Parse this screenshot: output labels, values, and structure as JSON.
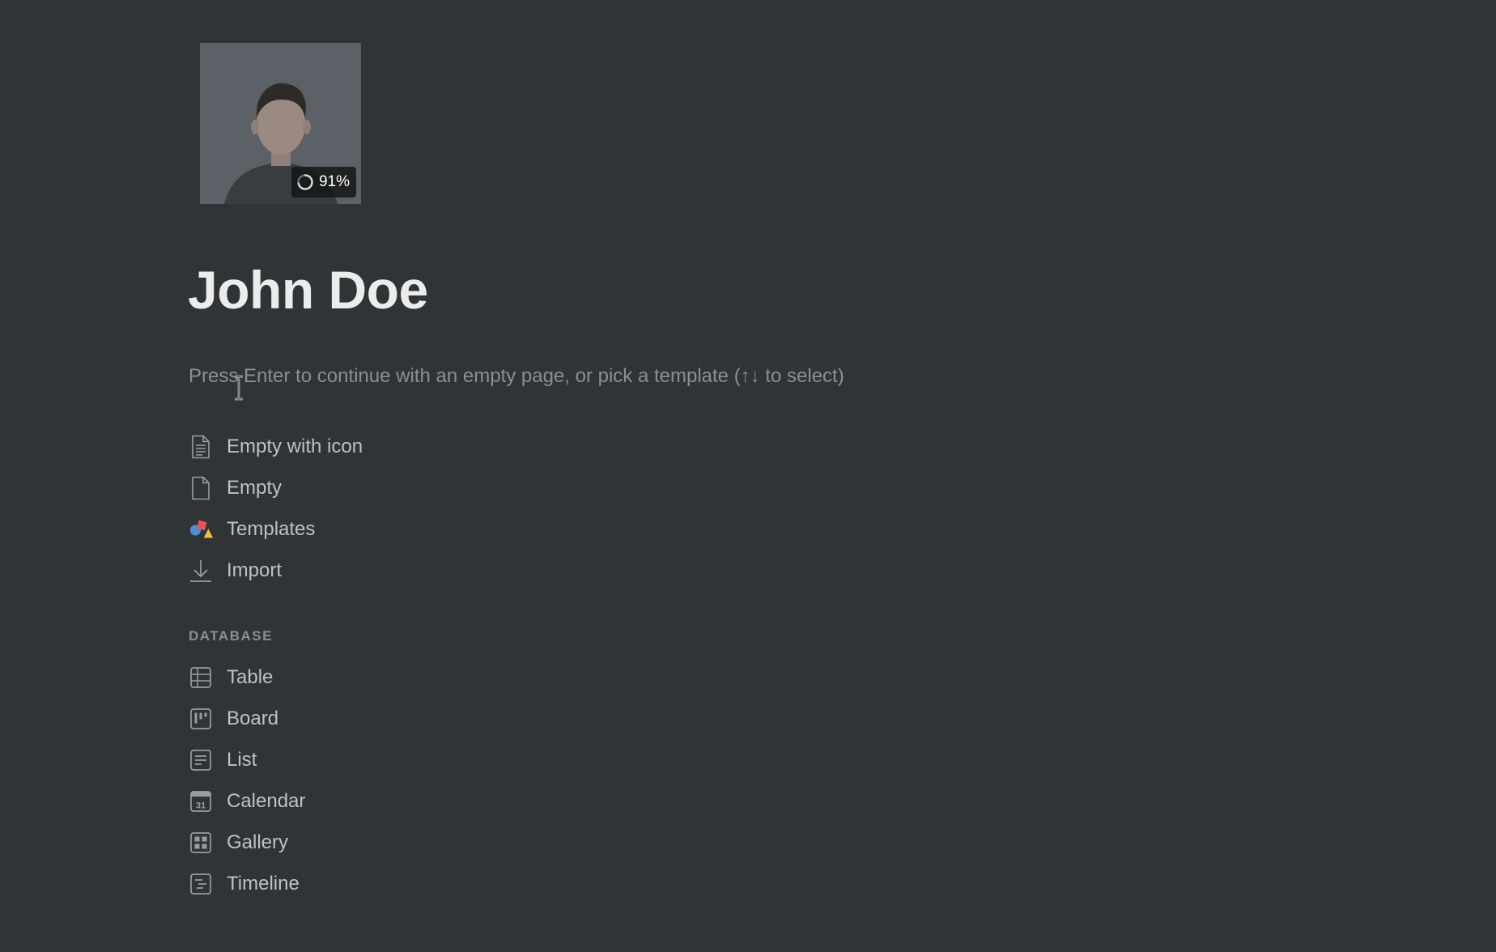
{
  "page": {
    "title": "John Doe",
    "hint": "Press Enter to continue with an empty page, or pick a template (↑↓ to select)"
  },
  "avatar": {
    "upload_progress": "91%"
  },
  "new_page_options": [
    {
      "label": "Empty with icon",
      "icon": "document-lines-icon"
    },
    {
      "label": "Empty",
      "icon": "document-icon"
    },
    {
      "label": "Templates",
      "icon": "templates-shapes-icon"
    },
    {
      "label": "Import",
      "icon": "download-icon"
    }
  ],
  "database": {
    "section_label": "DATABASE",
    "items": [
      {
        "label": "Table",
        "icon": "table-icon"
      },
      {
        "label": "Board",
        "icon": "board-icon"
      },
      {
        "label": "List",
        "icon": "list-icon"
      },
      {
        "label": "Calendar",
        "icon": "calendar-icon",
        "icon_text": "31"
      },
      {
        "label": "Gallery",
        "icon": "gallery-icon"
      },
      {
        "label": "Timeline",
        "icon": "timeline-icon"
      }
    ]
  },
  "colors": {
    "background": "#2f3437",
    "title": "#ececec",
    "muted_text": "#8c8f92",
    "item_text": "#bfc1c3"
  }
}
